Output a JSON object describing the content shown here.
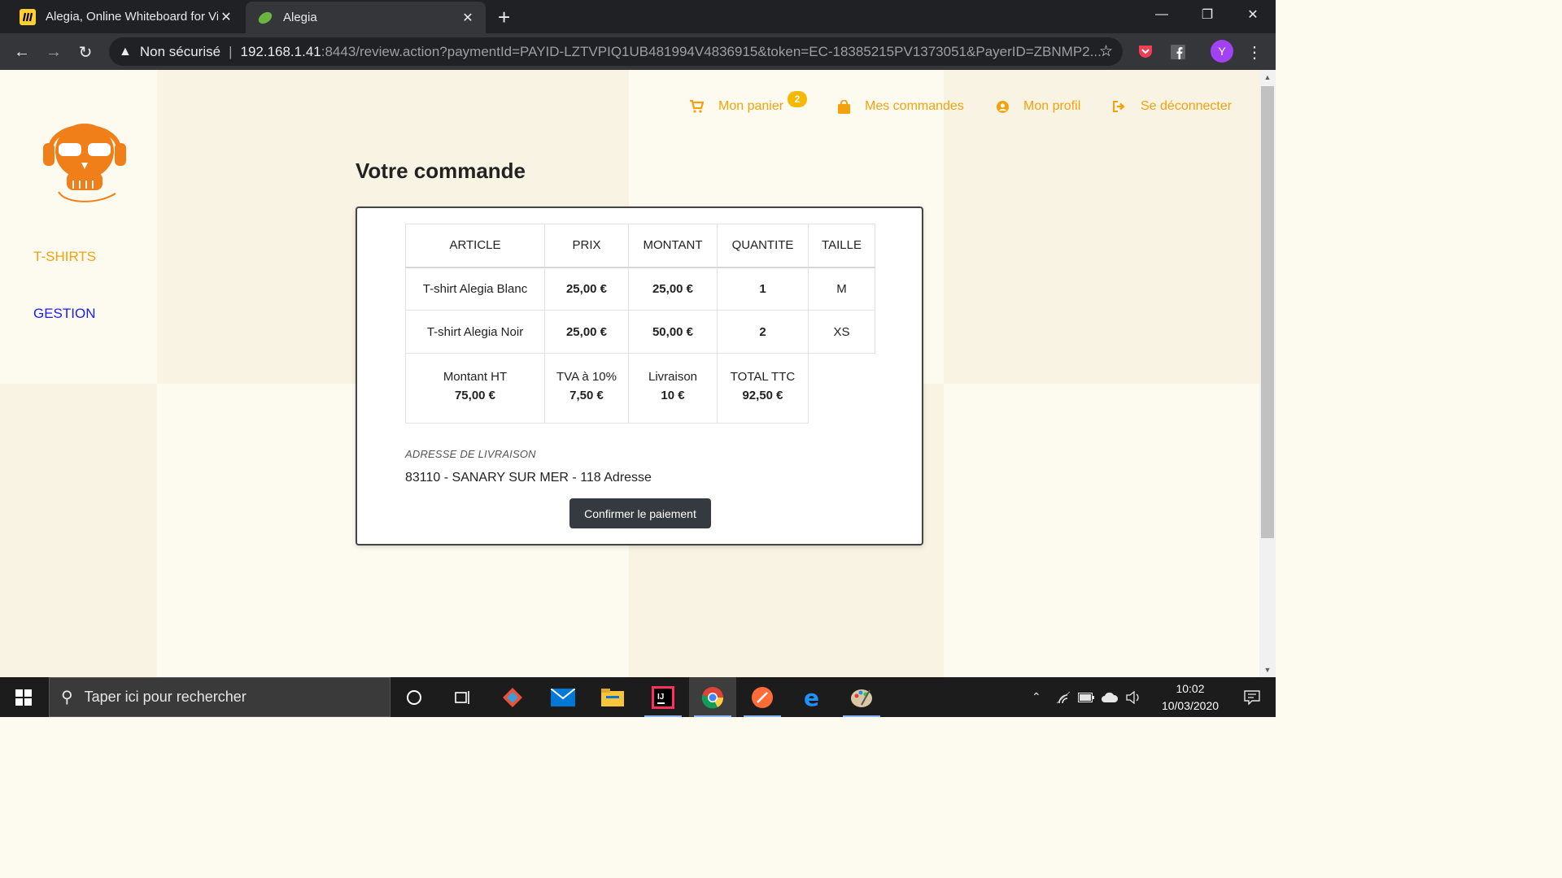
{
  "browser": {
    "tabs": [
      {
        "title": "Alegia, Online Whiteboard for Vi",
        "active": false
      },
      {
        "title": "Alegia",
        "active": true
      }
    ],
    "security_label": "Non sécurisé",
    "url_host": "192.168.1.41",
    "url_rest": ":8443/review.action?paymentId=PAYID-LZTVPIQ1UB481994V4836915&token=EC-18385215PV1373051&PayerID=ZBNMP2...",
    "profile_initial": "Y"
  },
  "sidebar": {
    "items": [
      {
        "label": "T-SHIRTS",
        "color": "#f5a10d"
      },
      {
        "label": "GESTION",
        "color": "#1a1aff"
      }
    ]
  },
  "nav": {
    "cart_label": "Mon panier",
    "cart_count": "2",
    "orders_label": "Mes commandes",
    "profile_label": "Mon profil",
    "logout_label": "Se déconnecter",
    "accent_color": "#f5a10d"
  },
  "order": {
    "title": "Votre commande",
    "columns": [
      "ARTICLE",
      "PRIX",
      "MONTANT",
      "QUANTITE",
      "TAILLE"
    ],
    "rows": [
      {
        "article": "T-shirt Alegia Blanc",
        "prix": "25,00 €",
        "montant": "25,00 €",
        "quantite": "1",
        "taille": "M"
      },
      {
        "article": "T-shirt Alegia Noir",
        "prix": "25,00 €",
        "montant": "50,00 €",
        "quantite": "2",
        "taille": "XS"
      }
    ],
    "totals": [
      {
        "label": "Montant HT",
        "value": "75,00 €"
      },
      {
        "label": "TVA à 10%",
        "value": "7,50 €"
      },
      {
        "label": "Livraison",
        "value": "10 €"
      },
      {
        "label": "TOTAL TTC",
        "value": "92,50 €"
      }
    ],
    "address_label": "ADRESSE DE LIVRAISON",
    "address_value": "83110 - SANARY SUR MER - 118 Adresse",
    "confirm_label": "Confirmer le paiement"
  },
  "taskbar": {
    "search_placeholder": "Taper ici pour rechercher",
    "time": "10:02",
    "date": "10/03/2020"
  }
}
